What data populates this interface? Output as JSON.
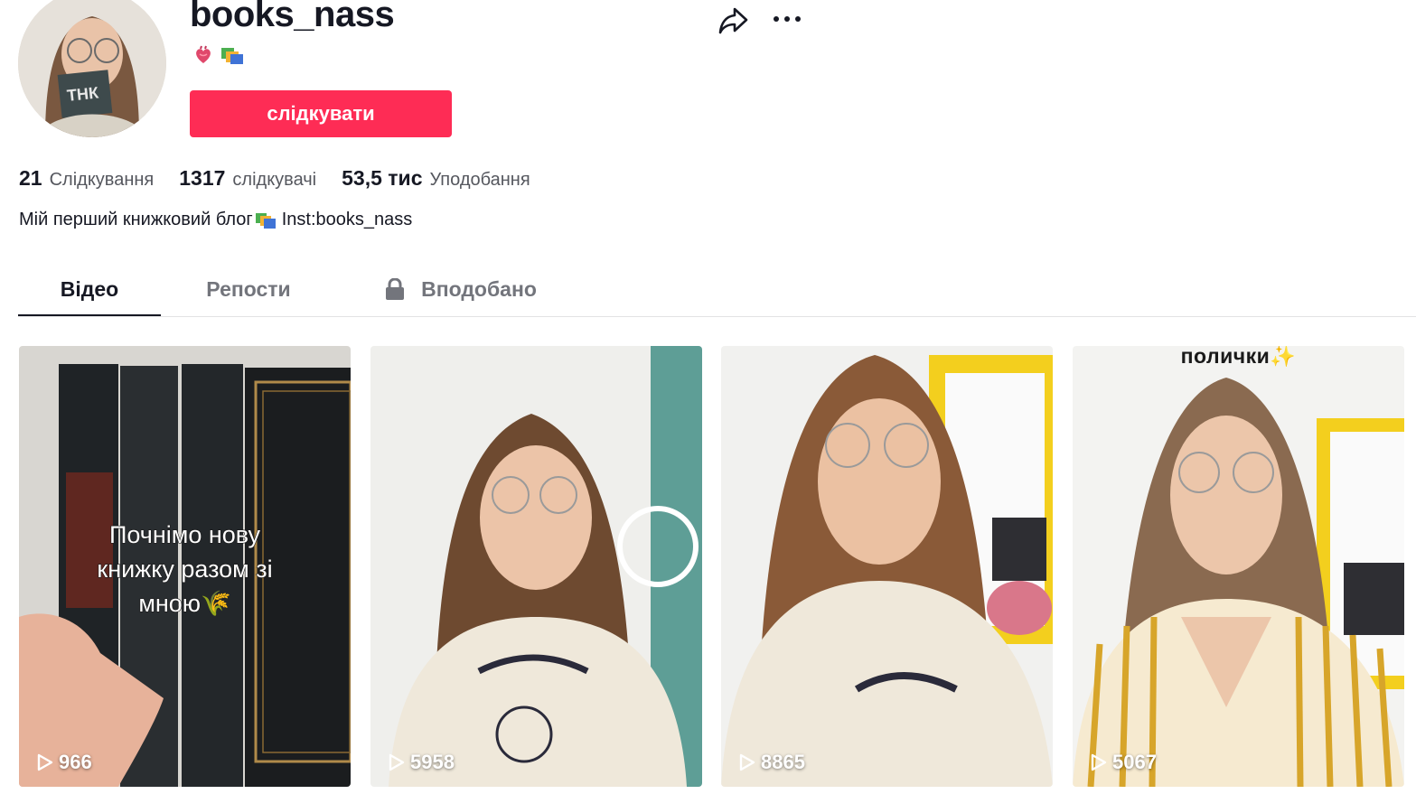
{
  "profile": {
    "username": "books_nass",
    "bio_emojis": [
      "anatomical-heart",
      "books"
    ],
    "follow_label": "слідкувати",
    "bio_text": "Мій перший книжковий блог",
    "bio_suffix": "Inst:books_nass"
  },
  "stats": {
    "following_count": "21",
    "following_label": "Слідкування",
    "followers_count": "1317",
    "followers_label": "слідкувачі",
    "likes_count": "53,5 тис",
    "likes_label": "Уподобання"
  },
  "tabs": [
    {
      "label": "Відео",
      "active": true
    },
    {
      "label": "Репости",
      "active": false
    },
    {
      "label": "Вподобано",
      "active": false,
      "icon": "lock-icon"
    }
  ],
  "videos": [
    {
      "views": "966",
      "caption": [
        "Почнімо нову",
        "книжку разом зі",
        "мною🌾"
      ]
    },
    {
      "views": "5958"
    },
    {
      "views": "8865"
    },
    {
      "views": "5067",
      "caption_top": "полички✨"
    }
  ],
  "icons": {
    "share": "share-icon",
    "more": "more-icon",
    "play": "play-icon"
  },
  "colors": {
    "accent": "#fe2c55",
    "text": "#161823",
    "secondary": "#55575e"
  }
}
